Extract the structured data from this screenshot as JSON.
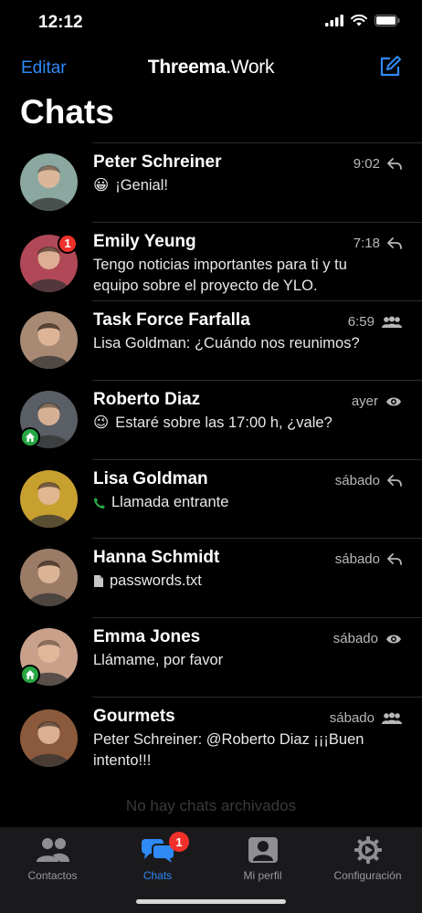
{
  "status_bar": {
    "time": "12:12"
  },
  "nav": {
    "edit_label": "Editar",
    "brand_bold": "Threema",
    "brand_light": ".Work"
  },
  "page_title": "Chats",
  "chats": [
    {
      "name": "Peter Schreiner",
      "time": "9:02",
      "status_icon": "reply-icon",
      "emoji": "😀",
      "message": "¡Genial!",
      "avatar_color": "#8aa7a0"
    },
    {
      "name": "Emily Yeung",
      "time": "7:18",
      "status_icon": "reply-icon",
      "unread": "1",
      "message": "Tengo noticias importantes para ti y tu equipo sobre el proyecto de YLO.",
      "avatar_color": "#b04858"
    },
    {
      "name": "Task Force Farfalla",
      "time": "6:59",
      "status_icon": "group-icon",
      "message": "Lisa Goldman: ¿Cuándo nos reunimos?",
      "avatar_color": "#a88a74"
    },
    {
      "name": "Roberto Diaz",
      "time": "ayer",
      "status_icon": "eye-icon",
      "home_badge": true,
      "emoji": "😉",
      "message": "Estaré sobre las 17:00 h, ¿vale?",
      "avatar_color": "#5a5f66"
    },
    {
      "name": "Lisa Goldman",
      "time": "sábado",
      "status_icon": "reply-icon",
      "message_icon": "phone-icon",
      "message": "Llamada entrante",
      "avatar_color": "#c7a030"
    },
    {
      "name": "Hanna Schmidt",
      "time": "sábado",
      "status_icon": "reply-icon",
      "message_icon": "file-icon",
      "message": "passwords.txt",
      "avatar_color": "#9a7b66"
    },
    {
      "name": "Emma Jones",
      "time": "sábado",
      "status_icon": "eye-icon",
      "home_badge": true,
      "message": "Llámame, por favor",
      "avatar_color": "#c9a08a"
    },
    {
      "name": "Gourmets",
      "time": "sábado",
      "status_icon": "group-icon",
      "message": "Peter Schreiner: @Roberto Diaz ¡¡¡Buen intento!!!",
      "avatar_color": "#8b5a3c"
    }
  ],
  "archived_text": "No hay chats archivados",
  "tabs": [
    {
      "label": "Contactos",
      "icon": "contacts-icon"
    },
    {
      "label": "Chats",
      "icon": "chats-icon",
      "badge": "1",
      "active": true
    },
    {
      "label": "Mi perfil",
      "icon": "profile-icon"
    },
    {
      "label": "Configuración",
      "icon": "gear-icon"
    }
  ],
  "colors": {
    "accent": "#2f8af7",
    "badge": "#f0302b",
    "home_badge": "#28a745",
    "background": "#000000",
    "tabbar": "#1a1a1c"
  }
}
